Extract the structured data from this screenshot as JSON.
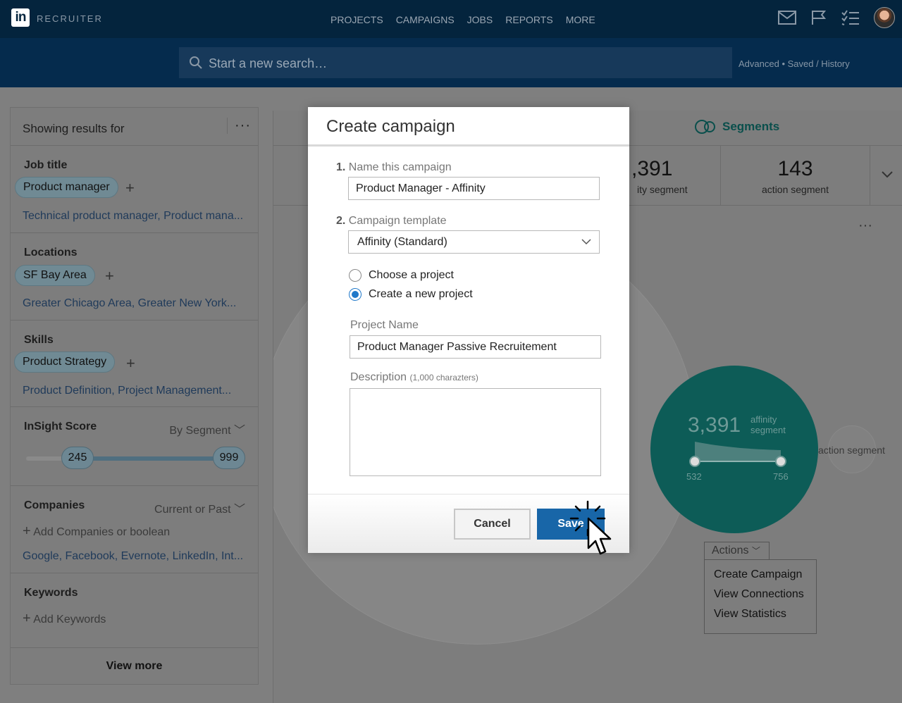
{
  "app": {
    "logo_text": "in",
    "brand": "RECRUITER",
    "nav": [
      "PROJECTS",
      "CAMPAIGNS",
      "JOBS",
      "REPORTS",
      "MORE"
    ]
  },
  "search": {
    "placeholder": "Start a new search…",
    "link_advanced": "Advanced",
    "link_sep": " • ",
    "link_saved": "Saved / History"
  },
  "filters": {
    "title": "Showing results for",
    "more_dots": "···",
    "job_title": {
      "label": "Job title",
      "pill": "Product manager",
      "suggestions": "Technical product manager, Product mana..."
    },
    "locations": {
      "label": "Locations",
      "pill": "SF Bay Area",
      "suggestions": "Greater Chicago Area, Greater New York..."
    },
    "skills": {
      "label": "Skills",
      "pill": "Product Strategy",
      "suggestions": "Product Definition, Project Management..."
    },
    "insight": {
      "label": "InSight Score",
      "mode": "By Segment",
      "min": "245",
      "max": "999"
    },
    "companies": {
      "label": "Companies",
      "mode": "Current or Past",
      "add": "Add Companies or boolean",
      "suggestions": "Google, Facebook, Evernote, LinkedIn, Int..."
    },
    "keywords": {
      "label": "Keywords",
      "add": "Add Keywords"
    },
    "view_more": "View more"
  },
  "segments": {
    "tab": "Segments",
    "stat1": {
      "num": ",391",
      "label": "ity segment"
    },
    "stat2": {
      "num": "143",
      "label": "action segment"
    },
    "more_dots": "···",
    "affinity_num": "3,391",
    "affinity_label_1": "affinity",
    "affinity_label_2": "segment",
    "range_min": "532",
    "range_max": "756",
    "action_label": "action segment",
    "actions_button": "Actions",
    "actions_menu": [
      "Create Campaign",
      "View Connections",
      "View Statistics"
    ]
  },
  "modal": {
    "title": "Create campaign",
    "step1_num": "1.",
    "step1_label": "Name this campaign",
    "campaign_name": "Product Manager - Affinity",
    "step2_num": "2.",
    "step2_label": "Campaign template",
    "template_value": "Affinity (Standard)",
    "radio_choose": "Choose a project",
    "radio_create": "Create a new project",
    "project_name_label": "Project Name",
    "project_name_value": "Product Manager Passive Recruitement",
    "description_label": "Description",
    "description_hint": "(1,000 charazters)",
    "cancel": "Cancel",
    "save": "Save"
  },
  "colors": {
    "navy": "#04243d",
    "teal": "#0d5c57",
    "primary_blue": "#1866a8"
  }
}
